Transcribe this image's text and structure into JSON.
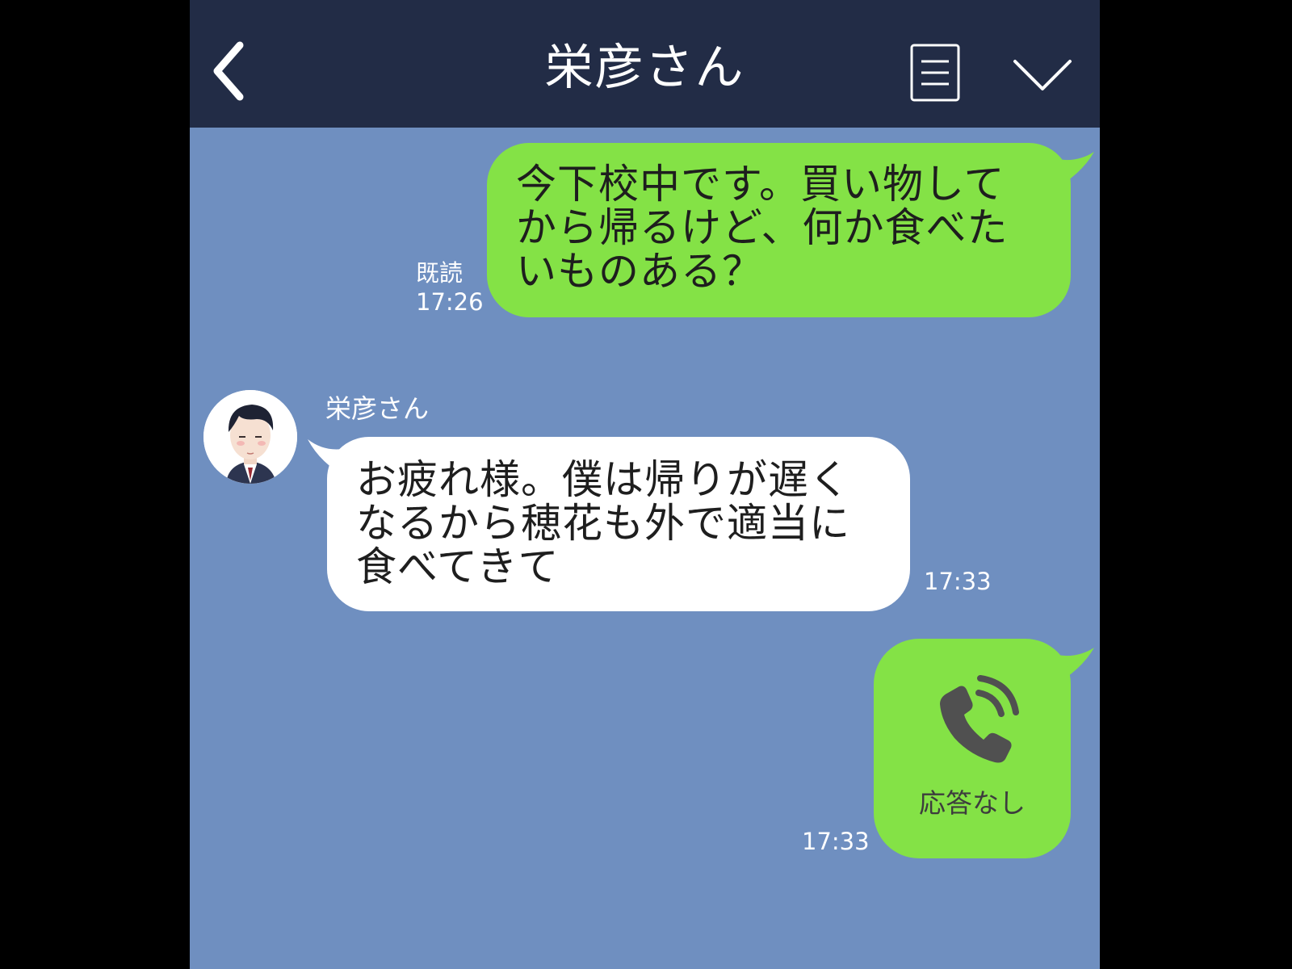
{
  "header": {
    "title": "栄彦さん",
    "back_icon": "chevron-left-icon",
    "menu_icon": "menu-icon",
    "dropdown_icon": "chevron-down-icon"
  },
  "messages": [
    {
      "side": "right",
      "text": "今下校中です。買い物してから帰るけど、何か食べたいものある？",
      "read_label": "既読",
      "time": "17:26"
    },
    {
      "side": "left",
      "sender": "栄彦さん",
      "text": "お疲れ様。僕は帰りが遅くなるから穂花も外で適当に食べてきて",
      "time": "17:33"
    },
    {
      "side": "right",
      "type": "call",
      "call_icon": "phone-call-icon",
      "call_status": "応答なし",
      "time": "17:33"
    }
  ],
  "colors": {
    "header_bg": "#222c46",
    "chat_bg": "#6f8fc0",
    "sent_bubble": "#84e246",
    "received_bubble": "#ffffff"
  }
}
